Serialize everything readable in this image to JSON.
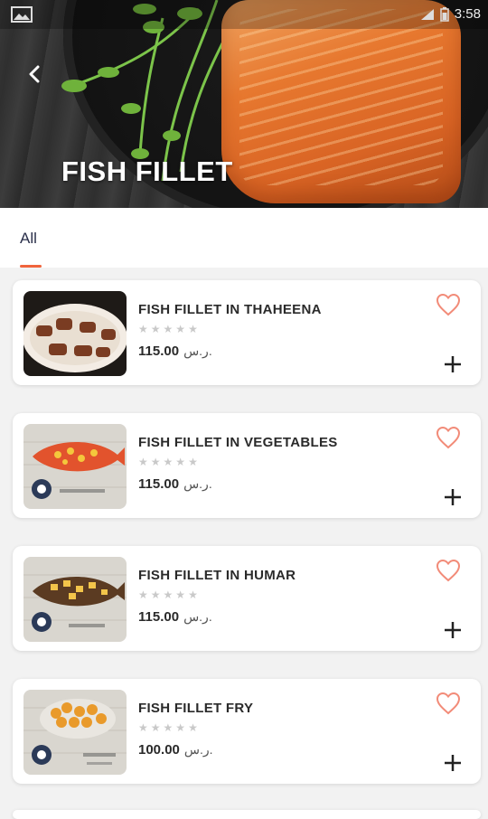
{
  "status_bar": {
    "clock": "3:58"
  },
  "header": {
    "title": "FISH FILLET"
  },
  "tabs": [
    {
      "label": "All"
    }
  ],
  "items": [
    {
      "name": "FISH FILLET IN THAHEENA",
      "price": "115.00",
      "currency": "ر.س."
    },
    {
      "name": "FISH FILLET IN VEGETABLES",
      "price": "115.00",
      "currency": "ر.س."
    },
    {
      "name": "FISH FILLET IN HUMAR",
      "price": "115.00",
      "currency": "ر.س."
    },
    {
      "name": "FISH FILLET FRY",
      "price": "100.00",
      "currency": "ر.س."
    }
  ],
  "colors": {
    "accent": "#f0643c",
    "heart": "#f28b78",
    "star": "#c9c9c9",
    "text": "#2a2a2a"
  }
}
